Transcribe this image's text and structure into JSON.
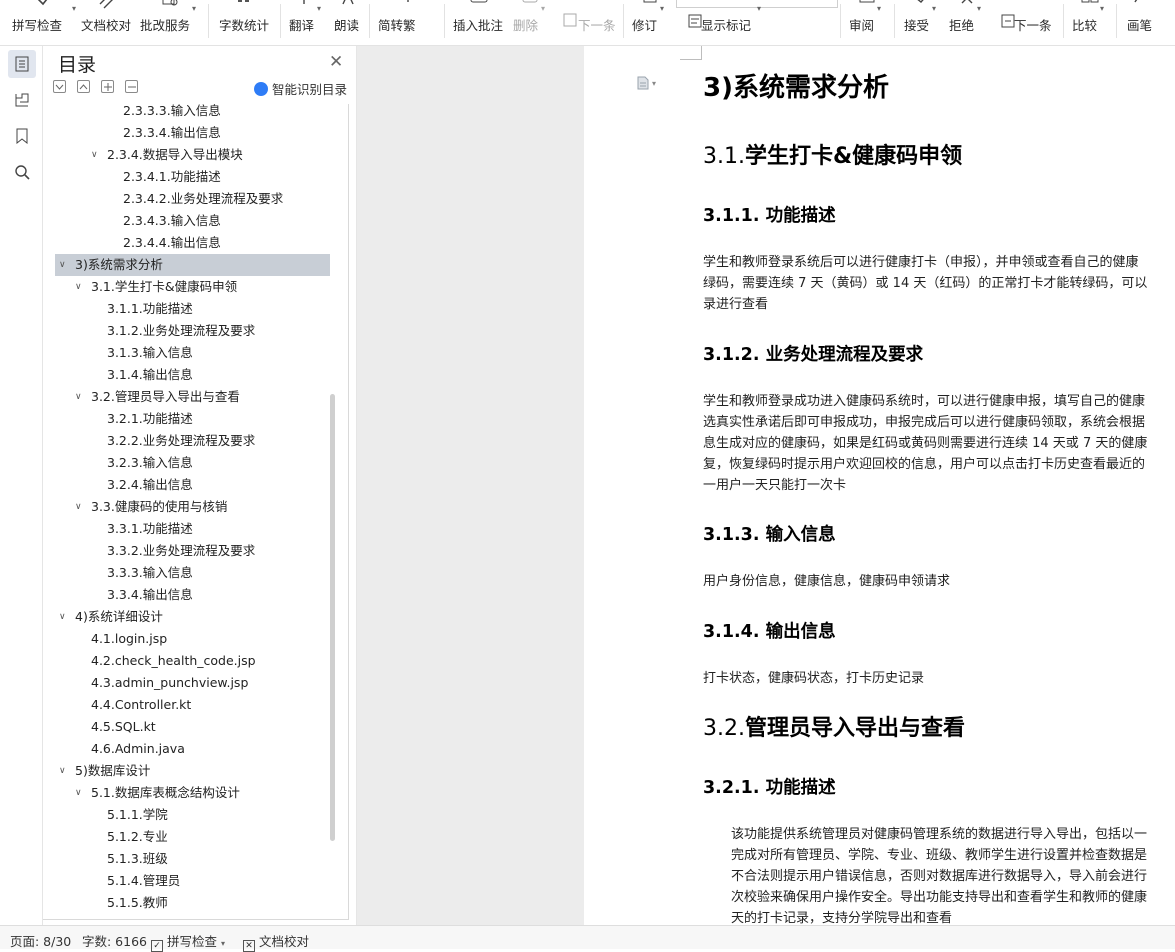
{
  "ribbon": {
    "spell_check": "拼写检查",
    "doc_proof": "文档校对",
    "revision_service": "批改服务",
    "word_count": "字数统计",
    "translate": "翻译",
    "read_aloud": "朗读",
    "simp_trad": "简转繁",
    "insert_comment": "插入批注",
    "delete": "删除",
    "next_comment": "下一条",
    "track_changes": "修订",
    "show_markup": "显示标记",
    "review": "审阅",
    "accept": "接受",
    "reject": "拒绝",
    "next_change": "下一条",
    "compare": "比较",
    "pen": "画笔"
  },
  "toc": {
    "title": "目录",
    "smart_label": "智能识别目录",
    "items": [
      {
        "label": "2.3.3.3.输入信息"
      },
      {
        "label": "2.3.3.4.输出信息"
      },
      {
        "label": "2.3.4.数据导入导出模块"
      },
      {
        "label": "2.3.4.1.功能描述"
      },
      {
        "label": "2.3.4.2.业务处理流程及要求"
      },
      {
        "label": "2.3.4.3.输入信息"
      },
      {
        "label": "2.3.4.4.输出信息"
      },
      {
        "label": "3)系统需求分析"
      },
      {
        "label": "3.1.学生打卡&健康码申领"
      },
      {
        "label": "3.1.1.功能描述"
      },
      {
        "label": "3.1.2.业务处理流程及要求"
      },
      {
        "label": "3.1.3.输入信息"
      },
      {
        "label": "3.1.4.输出信息"
      },
      {
        "label": "3.2.管理员导入导出与查看"
      },
      {
        "label": "3.2.1.功能描述"
      },
      {
        "label": "3.2.2.业务处理流程及要求"
      },
      {
        "label": "3.2.3.输入信息"
      },
      {
        "label": "3.2.4.输出信息"
      },
      {
        "label": "3.3.健康码的使用与核销"
      },
      {
        "label": "3.3.1.功能描述"
      },
      {
        "label": "3.3.2.业务处理流程及要求"
      },
      {
        "label": "3.3.3.输入信息"
      },
      {
        "label": "3.3.4.输出信息"
      },
      {
        "label": "4)系统详细设计"
      },
      {
        "label": "4.1.login.jsp"
      },
      {
        "label": "4.2.check_health_code.jsp"
      },
      {
        "label": "4.3.admin_punchview.jsp"
      },
      {
        "label": "4.4.Controller.kt"
      },
      {
        "label": "4.5.SQL.kt"
      },
      {
        "label": "4.6.Admin.java"
      },
      {
        "label": "5)数据库设计"
      },
      {
        "label": "5.1.数据库表概念结构设计"
      },
      {
        "label": "5.1.1.学院"
      },
      {
        "label": "5.1.2.专业"
      },
      {
        "label": "5.1.3.班级"
      },
      {
        "label": "5.1.4.管理员"
      },
      {
        "label": "5.1.5.教师"
      }
    ]
  },
  "doc": {
    "h_3": "3)系统需求分析",
    "h_31_num": "3.1.",
    "h_31_text": "学生打卡&健康码申领",
    "h_311": "3.1.1. 功能描述",
    "p_311": [
      "学生和教师登录系统后可以进行健康打卡（申报），并申领或查看自己的健康",
      "绿码，需要连续 7 天（黄码）或 14 天（红码）的正常打卡才能转绿码，可以",
      "录进行查看"
    ],
    "h_312": "3.1.2. 业务处理流程及要求",
    "p_312": [
      "学生和教师登录成功进入健康码系统时，可以进行健康申报，填写自己的健康",
      "选真实性承诺后即可申报成功，申报完成后可以进行健康码领取，系统会根据",
      "息生成对应的健康码，如果是红码或黄码则需要进行连续 14 天或 7 天的健康",
      "复，恢复绿码时提示用户欢迎回校的信息，用户可以点击打卡历史查看最近的",
      "一用户一天只能打一次卡"
    ],
    "h_313": "3.1.3. 输入信息",
    "p_313": "用户身份信息，健康信息，健康码申领请求",
    "h_314": "3.1.4. 输出信息",
    "p_314": "打卡状态，健康码状态，打卡历史记录",
    "h_32_num": "3.2.",
    "h_32_text": "管理员导入导出与查看",
    "h_321": "3.2.1. 功能描述",
    "p_321": [
      "该功能提供系统管理员对健康码管理系统的数据进行导入导出，包括以一",
      "完成对所有管理员、学院、专业、班级、教师学生进行设置并检查数据是",
      "不合法则提示用户错误信息，否则对数据库进行数据导入，导入前会进行",
      "次校验来确保用户操作安全。导出功能支持导出和查看学生和教师的健康",
      "天的打卡记录，支持分学院导出和查看"
    ]
  },
  "status": {
    "page": "页面: 8/30",
    "words": "字数: 6166",
    "spell": "拼写检查",
    "proof": "文档校对"
  }
}
